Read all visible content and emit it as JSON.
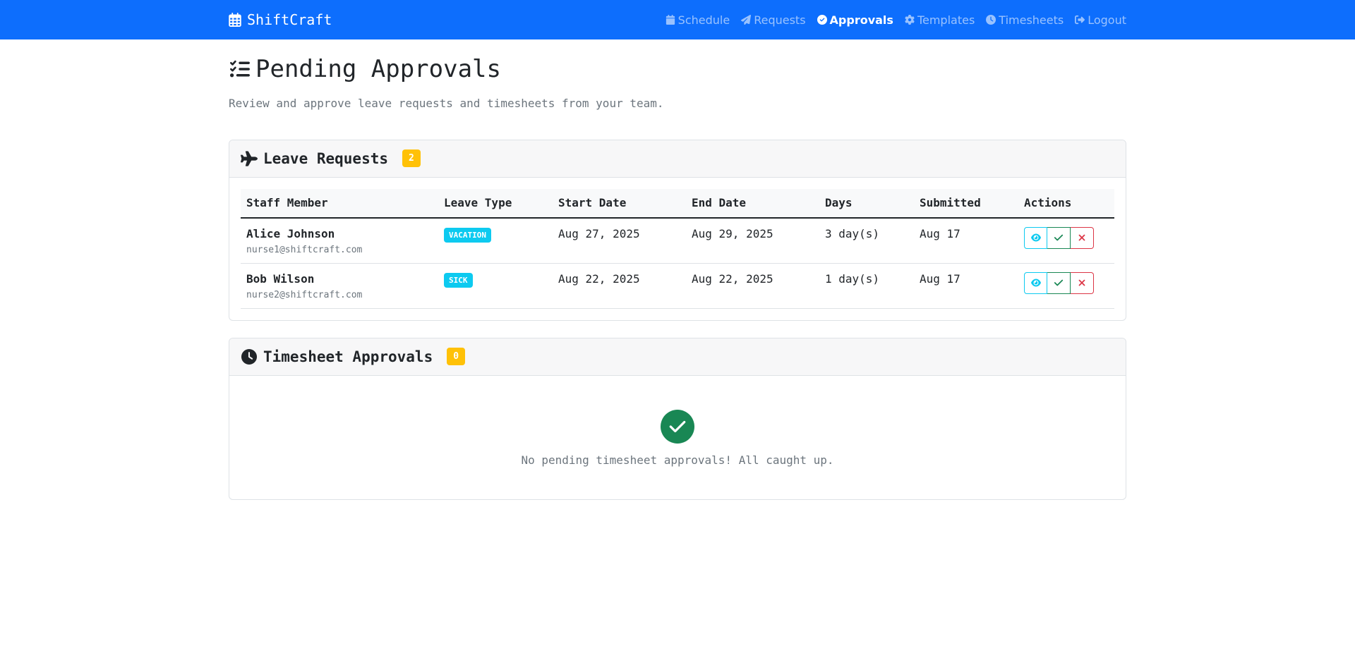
{
  "navbar": {
    "brand": "ShiftCraft",
    "links": [
      {
        "label": "Schedule",
        "icon": "calendar-icon",
        "active": false
      },
      {
        "label": "Requests",
        "icon": "paper-plane-icon",
        "active": false
      },
      {
        "label": "Approvals",
        "icon": "check-circle-icon",
        "active": true
      },
      {
        "label": "Templates",
        "icon": "gear-icon",
        "active": false
      },
      {
        "label": "Timesheets",
        "icon": "clock-icon",
        "active": false
      },
      {
        "label": "Logout",
        "icon": "logout-icon",
        "active": false
      }
    ]
  },
  "page": {
    "title": "Pending Approvals",
    "subtitle": "Review and approve leave requests and timesheets from your team."
  },
  "leave": {
    "title": "Leave Requests",
    "count": "2",
    "columns": [
      "Staff Member",
      "Leave Type",
      "Start Date",
      "End Date",
      "Days",
      "Submitted",
      "Actions"
    ],
    "rows": [
      {
        "name": "Alice Johnson",
        "email": "nurse1@shiftcraft.com",
        "type": "VACATION",
        "start": "Aug 27, 2025",
        "end": "Aug 29, 2025",
        "days": "3 day(s)",
        "submitted": "Aug 17"
      },
      {
        "name": "Bob Wilson",
        "email": "nurse2@shiftcraft.com",
        "type": "SICK",
        "start": "Aug 22, 2025",
        "end": "Aug 22, 2025",
        "days": "1 day(s)",
        "submitted": "Aug 17"
      }
    ]
  },
  "timesheets": {
    "title": "Timesheet Approvals",
    "count": "0",
    "empty_message": "No pending timesheet approvals! All caught up."
  },
  "colors": {
    "primary": "#0d6efd",
    "warning": "#ffc107",
    "info": "#0dcaf0",
    "success": "#198754",
    "danger": "#dc3545"
  }
}
